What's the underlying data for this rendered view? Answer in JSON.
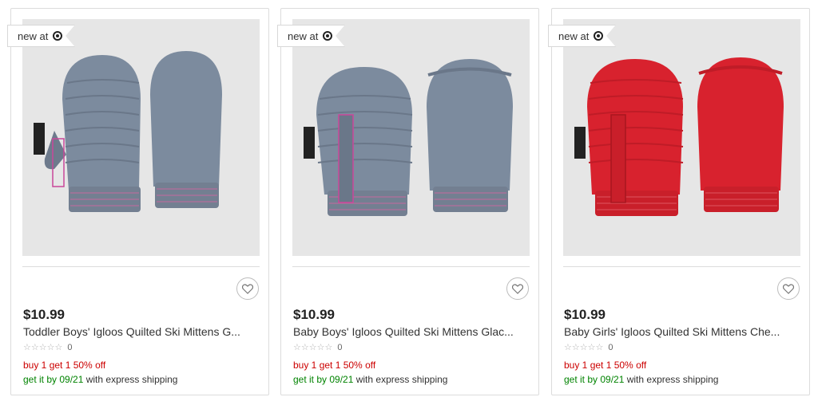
{
  "badge": {
    "text": "new at",
    "icon": "target-bullseye-icon"
  },
  "favorite_icon": "heart-icon",
  "colors": {
    "promo": "#cc0000",
    "shipping_date": "#008300",
    "badge_border": "#d8d8d8"
  },
  "products": [
    {
      "price": "$10.99",
      "title": "Toddler Boys' Igloos Quilted Ski Mittens G...",
      "stars": "☆☆☆☆☆",
      "rating_count": "0",
      "promo": "buy 1 get 1 50% off",
      "ship_prefix": "get it by 09/21",
      "ship_suffix": " with express shipping",
      "image_color": "#7c8b9e"
    },
    {
      "price": "$10.99",
      "title": "Baby Boys' Igloos Quilted Ski Mittens Glac...",
      "stars": "☆☆☆☆☆",
      "rating_count": "0",
      "promo": "buy 1 get 1 50% off",
      "ship_prefix": "get it by 09/21",
      "ship_suffix": " with express shipping",
      "image_color": "#7c8b9e"
    },
    {
      "price": "$10.99",
      "title": "Baby Girls' Igloos Quilted Ski Mittens Che...",
      "stars": "☆☆☆☆☆",
      "rating_count": "0",
      "promo": "buy 1 get 1 50% off",
      "ship_prefix": "get it by 09/21",
      "ship_suffix": " with express shipping",
      "image_color": "#d8222e"
    }
  ]
}
